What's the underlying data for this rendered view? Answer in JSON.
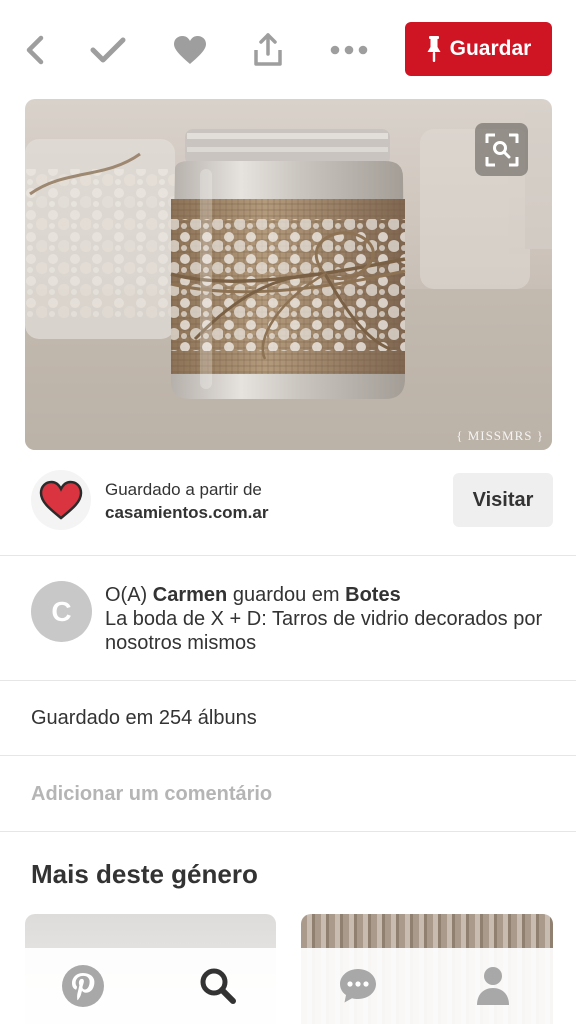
{
  "toolbar": {
    "back_icon": "chevron-left-icon",
    "done_icon": "check-icon",
    "like_icon": "heart-icon",
    "share_icon": "share-icon",
    "more_icon": "more-dots-icon",
    "save_label": "Guardar",
    "save_color": "#cf1523"
  },
  "pin": {
    "watermark": "{ MISSMRS }",
    "lens_icon": "visual-search-icon"
  },
  "source": {
    "label": "Guardado a partir de",
    "site": "casamientos.com.ar",
    "visit_label": "Visitar"
  },
  "saver": {
    "avatar_initial": "C",
    "prefix": "O(A) ",
    "name": "Carmen",
    "verb": " guardou em ",
    "board": "Botes",
    "description": "La boda de X + D: Tarros de vidrio decorados por nosotros mismos"
  },
  "saved_count": "Guardado em 254 álbuns",
  "comment_placeholder": "Adicionar um comentário",
  "more_title": "Mais deste género",
  "bottom_nav": {
    "items": [
      "pinterest-logo-icon",
      "search-icon",
      "chat-icon",
      "profile-icon"
    ]
  }
}
